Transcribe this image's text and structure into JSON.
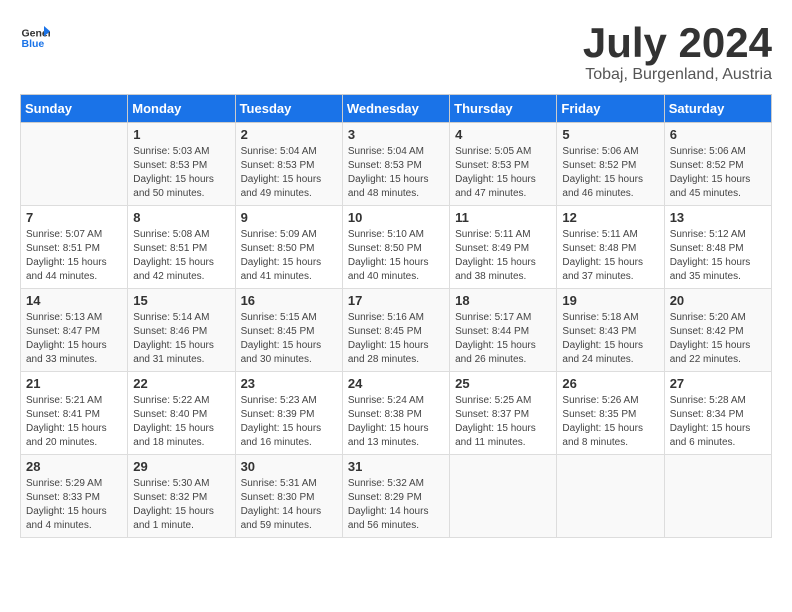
{
  "header": {
    "logo_general": "General",
    "logo_blue": "Blue",
    "month_year": "July 2024",
    "location": "Tobaj, Burgenland, Austria"
  },
  "days_of_week": [
    "Sunday",
    "Monday",
    "Tuesday",
    "Wednesday",
    "Thursday",
    "Friday",
    "Saturday"
  ],
  "weeks": [
    [
      {
        "day": "",
        "info": ""
      },
      {
        "day": "1",
        "info": "Sunrise: 5:03 AM\nSunset: 8:53 PM\nDaylight: 15 hours\nand 50 minutes."
      },
      {
        "day": "2",
        "info": "Sunrise: 5:04 AM\nSunset: 8:53 PM\nDaylight: 15 hours\nand 49 minutes."
      },
      {
        "day": "3",
        "info": "Sunrise: 5:04 AM\nSunset: 8:53 PM\nDaylight: 15 hours\nand 48 minutes."
      },
      {
        "day": "4",
        "info": "Sunrise: 5:05 AM\nSunset: 8:53 PM\nDaylight: 15 hours\nand 47 minutes."
      },
      {
        "day": "5",
        "info": "Sunrise: 5:06 AM\nSunset: 8:52 PM\nDaylight: 15 hours\nand 46 minutes."
      },
      {
        "day": "6",
        "info": "Sunrise: 5:06 AM\nSunset: 8:52 PM\nDaylight: 15 hours\nand 45 minutes."
      }
    ],
    [
      {
        "day": "7",
        "info": "Sunrise: 5:07 AM\nSunset: 8:51 PM\nDaylight: 15 hours\nand 44 minutes."
      },
      {
        "day": "8",
        "info": "Sunrise: 5:08 AM\nSunset: 8:51 PM\nDaylight: 15 hours\nand 42 minutes."
      },
      {
        "day": "9",
        "info": "Sunrise: 5:09 AM\nSunset: 8:50 PM\nDaylight: 15 hours\nand 41 minutes."
      },
      {
        "day": "10",
        "info": "Sunrise: 5:10 AM\nSunset: 8:50 PM\nDaylight: 15 hours\nand 40 minutes."
      },
      {
        "day": "11",
        "info": "Sunrise: 5:11 AM\nSunset: 8:49 PM\nDaylight: 15 hours\nand 38 minutes."
      },
      {
        "day": "12",
        "info": "Sunrise: 5:11 AM\nSunset: 8:48 PM\nDaylight: 15 hours\nand 37 minutes."
      },
      {
        "day": "13",
        "info": "Sunrise: 5:12 AM\nSunset: 8:48 PM\nDaylight: 15 hours\nand 35 minutes."
      }
    ],
    [
      {
        "day": "14",
        "info": "Sunrise: 5:13 AM\nSunset: 8:47 PM\nDaylight: 15 hours\nand 33 minutes."
      },
      {
        "day": "15",
        "info": "Sunrise: 5:14 AM\nSunset: 8:46 PM\nDaylight: 15 hours\nand 31 minutes."
      },
      {
        "day": "16",
        "info": "Sunrise: 5:15 AM\nSunset: 8:45 PM\nDaylight: 15 hours\nand 30 minutes."
      },
      {
        "day": "17",
        "info": "Sunrise: 5:16 AM\nSunset: 8:45 PM\nDaylight: 15 hours\nand 28 minutes."
      },
      {
        "day": "18",
        "info": "Sunrise: 5:17 AM\nSunset: 8:44 PM\nDaylight: 15 hours\nand 26 minutes."
      },
      {
        "day": "19",
        "info": "Sunrise: 5:18 AM\nSunset: 8:43 PM\nDaylight: 15 hours\nand 24 minutes."
      },
      {
        "day": "20",
        "info": "Sunrise: 5:20 AM\nSunset: 8:42 PM\nDaylight: 15 hours\nand 22 minutes."
      }
    ],
    [
      {
        "day": "21",
        "info": "Sunrise: 5:21 AM\nSunset: 8:41 PM\nDaylight: 15 hours\nand 20 minutes."
      },
      {
        "day": "22",
        "info": "Sunrise: 5:22 AM\nSunset: 8:40 PM\nDaylight: 15 hours\nand 18 minutes."
      },
      {
        "day": "23",
        "info": "Sunrise: 5:23 AM\nSunset: 8:39 PM\nDaylight: 15 hours\nand 16 minutes."
      },
      {
        "day": "24",
        "info": "Sunrise: 5:24 AM\nSunset: 8:38 PM\nDaylight: 15 hours\nand 13 minutes."
      },
      {
        "day": "25",
        "info": "Sunrise: 5:25 AM\nSunset: 8:37 PM\nDaylight: 15 hours\nand 11 minutes."
      },
      {
        "day": "26",
        "info": "Sunrise: 5:26 AM\nSunset: 8:35 PM\nDaylight: 15 hours\nand 8 minutes."
      },
      {
        "day": "27",
        "info": "Sunrise: 5:28 AM\nSunset: 8:34 PM\nDaylight: 15 hours\nand 6 minutes."
      }
    ],
    [
      {
        "day": "28",
        "info": "Sunrise: 5:29 AM\nSunset: 8:33 PM\nDaylight: 15 hours\nand 4 minutes."
      },
      {
        "day": "29",
        "info": "Sunrise: 5:30 AM\nSunset: 8:32 PM\nDaylight: 15 hours\nand 1 minute."
      },
      {
        "day": "30",
        "info": "Sunrise: 5:31 AM\nSunset: 8:30 PM\nDaylight: 14 hours\nand 59 minutes."
      },
      {
        "day": "31",
        "info": "Sunrise: 5:32 AM\nSunset: 8:29 PM\nDaylight: 14 hours\nand 56 minutes."
      },
      {
        "day": "",
        "info": ""
      },
      {
        "day": "",
        "info": ""
      },
      {
        "day": "",
        "info": ""
      }
    ]
  ]
}
